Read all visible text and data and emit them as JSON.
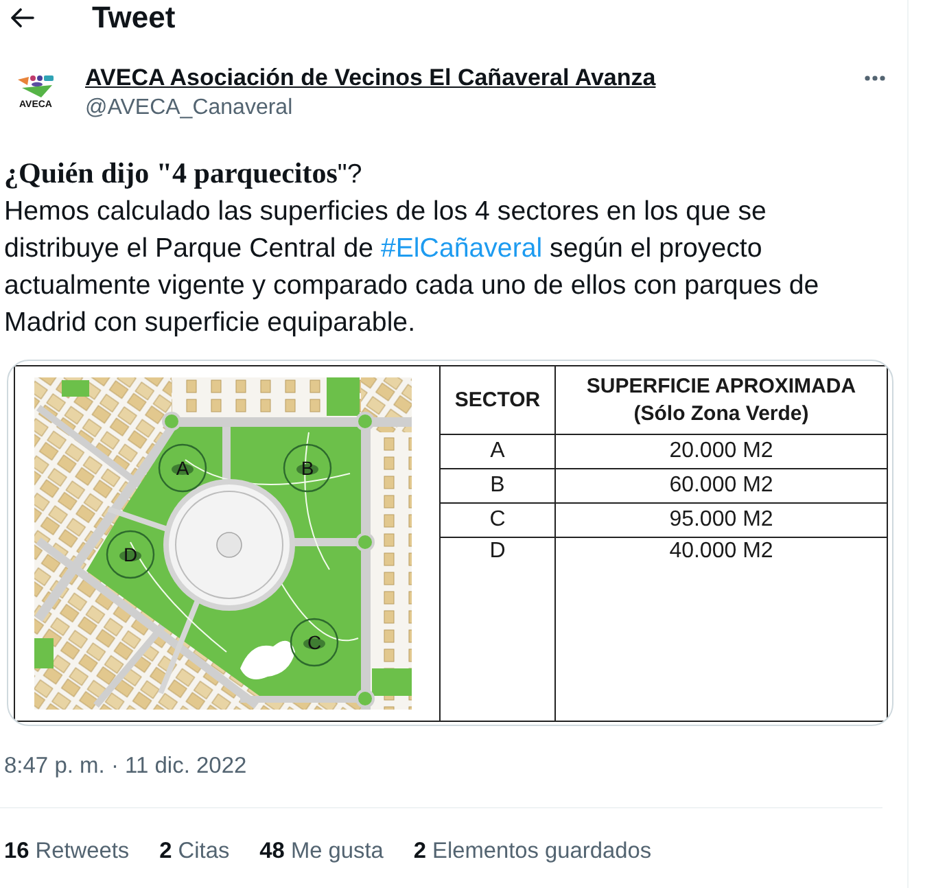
{
  "header": {
    "title": "Tweet"
  },
  "author": {
    "logo_text": "AVECA",
    "name": "AVECA Asociación de Vecinos El Cañaveral Avanza",
    "handle": "@AVECA_Canaveral"
  },
  "tweet": {
    "lead": "**¿Quién dijo \"4 parquecitos**\"?",
    "body": [
      {
        "kind": "text",
        "text": "Hemos calculado las superficies de los 4 sectores en los que se distribuye el Parque Central de "
      },
      {
        "kind": "hashtag",
        "text": "#ElCañaveral"
      },
      {
        "kind": "text",
        "text": " según el proyecto actualmente vigente y comparado cada uno de ellos con parques de Madrid con superficie equiparable."
      }
    ]
  },
  "media": {
    "map": {
      "sectors": [
        {
          "label": "A"
        },
        {
          "label": "B"
        },
        {
          "label": "D"
        },
        {
          "label": "C"
        }
      ]
    },
    "table": {
      "columns": [
        "SECTOR",
        "SUPERFICIE APROXIMADA (Sólo Zona Verde)"
      ],
      "rows": [
        [
          "A",
          "20.000 M2"
        ],
        [
          "B",
          "60.000 M2"
        ],
        [
          "C",
          "95.000 M2"
        ],
        [
          "D",
          "40.000 M2"
        ]
      ]
    }
  },
  "timestamp": "8:47 p. m. · 11 dic. 2022",
  "stats": [
    {
      "count": "16",
      "label": "Retweets"
    },
    {
      "count": "2",
      "label": "Citas"
    },
    {
      "count": "48",
      "label": "Me gusta"
    },
    {
      "count": "2",
      "label": "Elementos guardados"
    }
  ]
}
